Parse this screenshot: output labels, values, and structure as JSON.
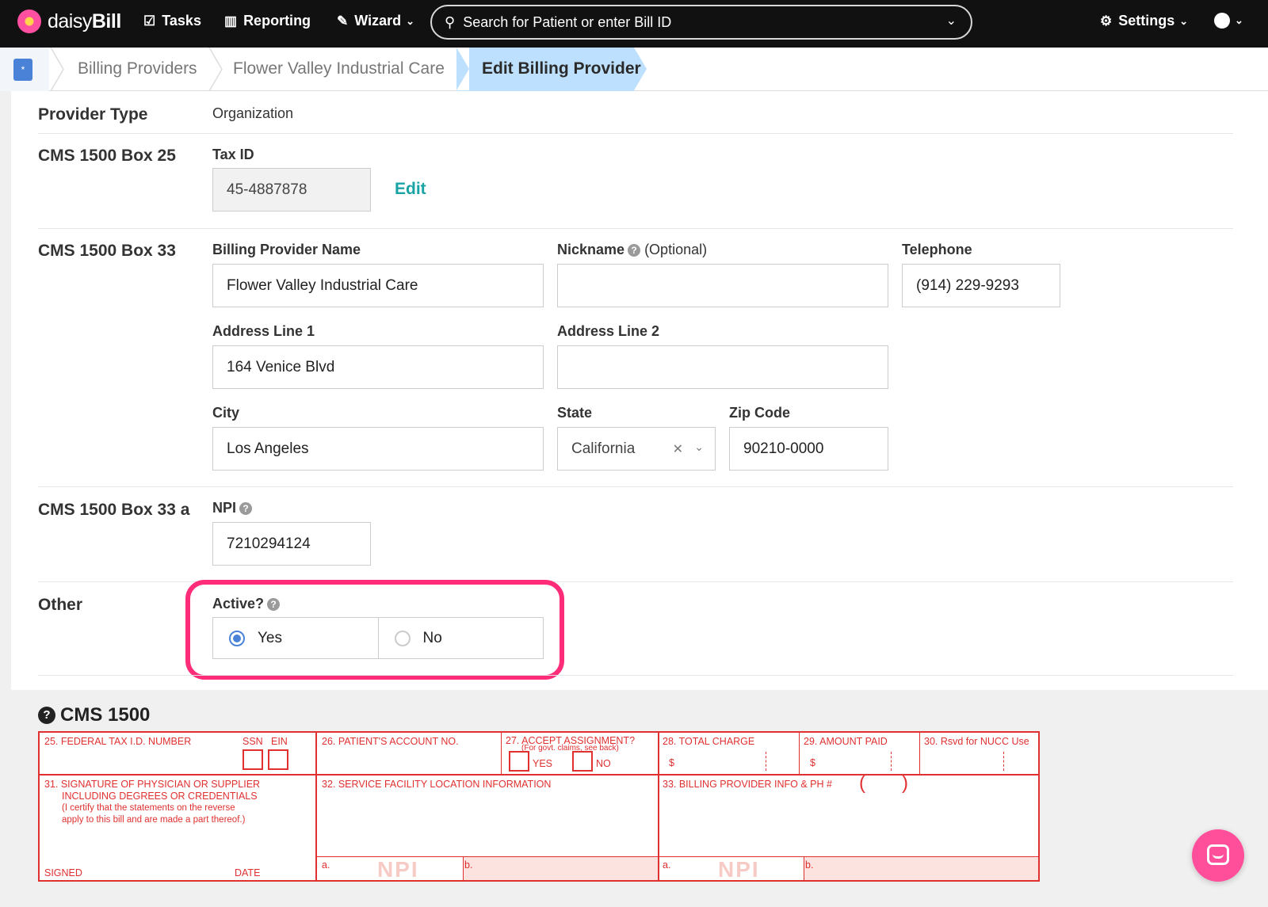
{
  "nav": {
    "brand_light": "daisy",
    "brand_bold": "Bill",
    "tasks": "Tasks",
    "reporting": "Reporting",
    "wizard": "Wizard",
    "search_placeholder": "Search for Patient or enter Bill ID",
    "settings": "Settings"
  },
  "breadcrumb": {
    "items": [
      "Billing Providers",
      "Flower Valley Industrial Care",
      "Edit Billing Provider"
    ]
  },
  "form": {
    "provider_type": {
      "section": "Provider Type",
      "value": "Organization"
    },
    "box25": {
      "section": "CMS 1500 Box 25",
      "tax_id_label": "Tax ID",
      "tax_id_value": "45-4887878",
      "edit_label": "Edit"
    },
    "box33": {
      "section": "CMS 1500 Box 33",
      "name_label": "Billing Provider Name",
      "name_value": "Flower Valley Industrial Care",
      "nickname_label": "Nickname",
      "nickname_optional": "(Optional)",
      "nickname_value": "",
      "telephone_label": "Telephone",
      "telephone_value": "(914) 229-9293",
      "address1_label": "Address Line 1",
      "address1_value": "164 Venice Blvd",
      "address2_label": "Address Line 2",
      "address2_value": "",
      "city_label": "City",
      "city_value": "Los Angeles",
      "state_label": "State",
      "state_value": "California",
      "zip_label": "Zip Code",
      "zip_value": "90210-0000"
    },
    "box33a": {
      "section": "CMS 1500 Box 33 a",
      "npi_label": "NPI",
      "npi_value": "7210294124"
    },
    "other": {
      "section": "Other",
      "active_label": "Active?",
      "yes": "Yes",
      "no": "No",
      "selected": "Yes"
    }
  },
  "cms": {
    "title": "CMS 1500",
    "f25": "25. FEDERAL TAX I.D. NUMBER",
    "ssn": "SSN",
    "ein": "EIN",
    "f26": "26. PATIENT'S ACCOUNT NO.",
    "f27": "27. ACCEPT ASSIGNMENT?",
    "f27_sub": "(For govt. claims, see back)",
    "yes": "YES",
    "no": "NO",
    "f28": "28. TOTAL CHARGE",
    "f29": "29. AMOUNT PAID",
    "f30": "30. Rsvd for NUCC Use",
    "dollar": "$",
    "f31_l1": "31. SIGNATURE OF PHYSICIAN OR SUPPLIER",
    "f31_l2": "INCLUDING DEGREES OR CREDENTIALS",
    "f31_l3": "(I certify that the statements on the reverse",
    "f31_l4": "apply to this bill and are made a part thereof.)",
    "signed": "SIGNED",
    "date": "DATE",
    "f32": "32. SERVICE FACILITY LOCATION INFORMATION",
    "f33": "33. BILLING PROVIDER INFO & PH #",
    "paren_open": "(",
    "paren_close": ")",
    "a": "a.",
    "b": "b.",
    "npi_wm": "NPI"
  },
  "colors": {
    "highlight": "#ff2c7a",
    "form_red": "#e03030",
    "link_teal": "#1aa3a3",
    "radio_blue": "#4a82d8"
  }
}
